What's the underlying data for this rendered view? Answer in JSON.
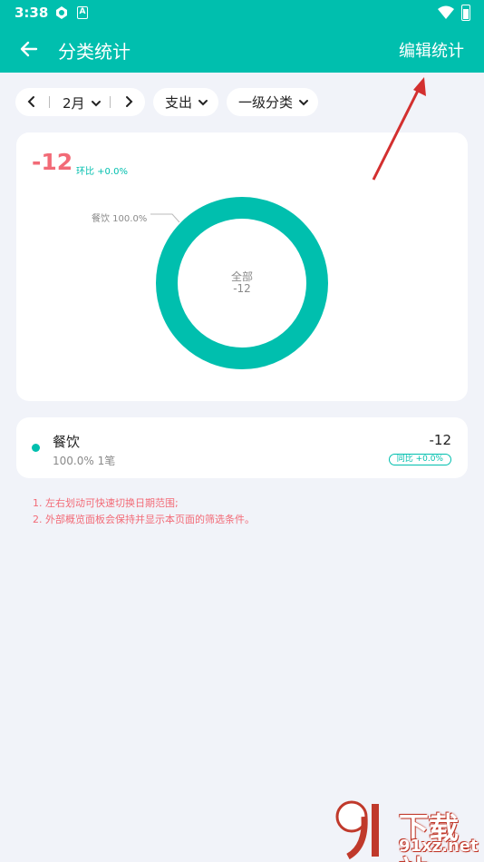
{
  "status_bar": {
    "time": "3:38",
    "notif_icon_b": "A"
  },
  "app_bar": {
    "title": "分类统计",
    "edit_label": "编辑统计"
  },
  "filters": {
    "month": "2月",
    "type": "支出",
    "level": "一级分类"
  },
  "summary": {
    "total": "-12",
    "compare": "环比 +0.0%"
  },
  "chart_data": {
    "type": "pie",
    "slices": [
      {
        "label": "餐饮",
        "percent": 100.0
      }
    ],
    "center_label": "全部",
    "center_value": "-12",
    "slice_label_text": "餐饮 100.0%"
  },
  "categories": [
    {
      "name": "餐饮",
      "sub": "100.0% 1笔",
      "amount": "-12",
      "badge": "同比 +0.0%"
    }
  ],
  "tips": [
    "1. 左右划动可快速切换日期范围;",
    "2. 外部概览面板会保持并显示本页面的筛选条件。"
  ],
  "watermark": {
    "text": "下载站",
    "url": "91xz.net"
  },
  "colors": {
    "primary": "#00bfae",
    "negative": "#f26b77",
    "background": "#f1f3f9",
    "annotation": "#d32f2f"
  },
  "icons": {
    "back": "back-arrow-icon",
    "prev": "chevron-left-icon",
    "next": "chevron-right-icon",
    "dropdown": "chevron-down-icon"
  }
}
